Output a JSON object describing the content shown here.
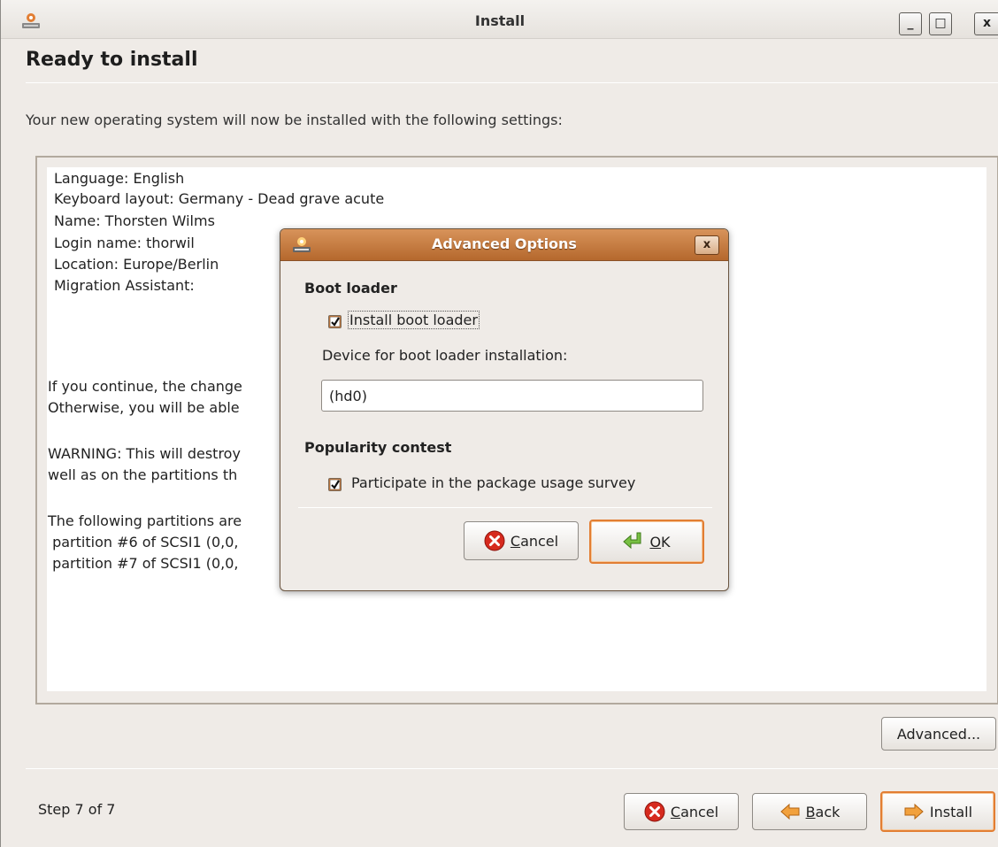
{
  "window": {
    "title": "Install",
    "controls": {
      "minimize": "_",
      "maximize": "□",
      "close": "x"
    }
  },
  "page": {
    "heading": "Ready to install",
    "intro": "Your new operating system will now be installed with the following settings:"
  },
  "summary": {
    "lines": [
      "Language: English",
      "Keyboard layout: Germany - Dead grave acute",
      "Name: Thorsten Wilms",
      "Login name: thorwil",
      "Location: Europe/Berlin",
      "Migration Assistant:"
    ],
    "partial_lines": [
      "If you continue, the change",
      "Otherwise, you will be able",
      "WARNING: This will destroy",
      "well as on the partitions th",
      "The following partitions are",
      " partition #6 of SCSI1 (0,0,",
      " partition #7 of SCSI1 (0,0,"
    ]
  },
  "buttons": {
    "advanced": "Advanced...",
    "cancel_prefix": "",
    "cancel_mnemonic": "C",
    "cancel_rest": "ancel",
    "back_mnemonic": "B",
    "back_rest": "ack",
    "install": "Install"
  },
  "footer": {
    "step": "Step 7 of 7"
  },
  "dialog": {
    "title": "Advanced Options",
    "close": "x",
    "boot_loader_heading": "Boot loader",
    "install_boot_loader_label": "Install boot loader",
    "install_boot_loader_checked": true,
    "device_label": "Device for boot loader installation:",
    "device_value": "(hd0)",
    "popularity_heading": "Popularity contest",
    "participate_label": "Participate in the package usage survey",
    "participate_checked": true,
    "cancel_mnemonic": "C",
    "cancel_rest": "ancel",
    "ok_mnemonic": "O",
    "ok_rest": "K"
  },
  "icons": {
    "app": "ubuntu-installer-icon",
    "cancel": "cancel-icon",
    "ok": "ok-icon",
    "back": "back-arrow-icon",
    "install": "forward-arrow-icon"
  },
  "colors": {
    "accent": "#e27e33",
    "dialog_title": "#c4773a",
    "cancel_red": "#d62a1e",
    "ok_green": "#6db33f"
  }
}
